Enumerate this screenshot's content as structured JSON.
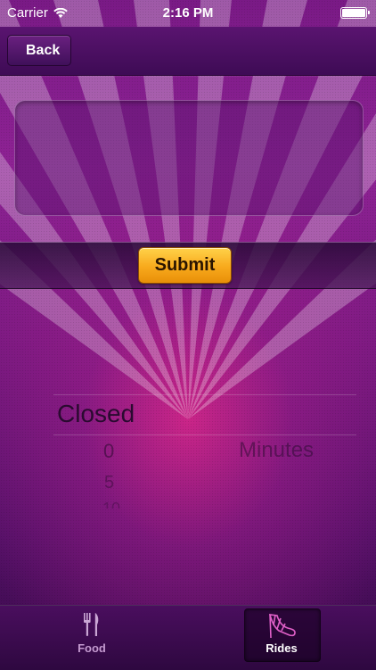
{
  "status_bar": {
    "carrier": "Carrier",
    "time": "2:16 PM"
  },
  "nav": {
    "back_label": "Back"
  },
  "comment_box": {
    "value": "",
    "placeholder": ""
  },
  "toolbar": {
    "submit_label": "Submit"
  },
  "picker": {
    "selected_value": "Closed",
    "options": [
      "0",
      "5",
      "10"
    ],
    "unit": "Minutes"
  },
  "tabbar": {
    "tabs": [
      {
        "label": "Food",
        "icon": "fork-knife-icon",
        "selected": false
      },
      {
        "label": "Rides",
        "icon": "high-heel-shoe-icon",
        "selected": true
      }
    ]
  },
  "colors": {
    "accent": "#f8a91c",
    "background": "#8e2294"
  }
}
